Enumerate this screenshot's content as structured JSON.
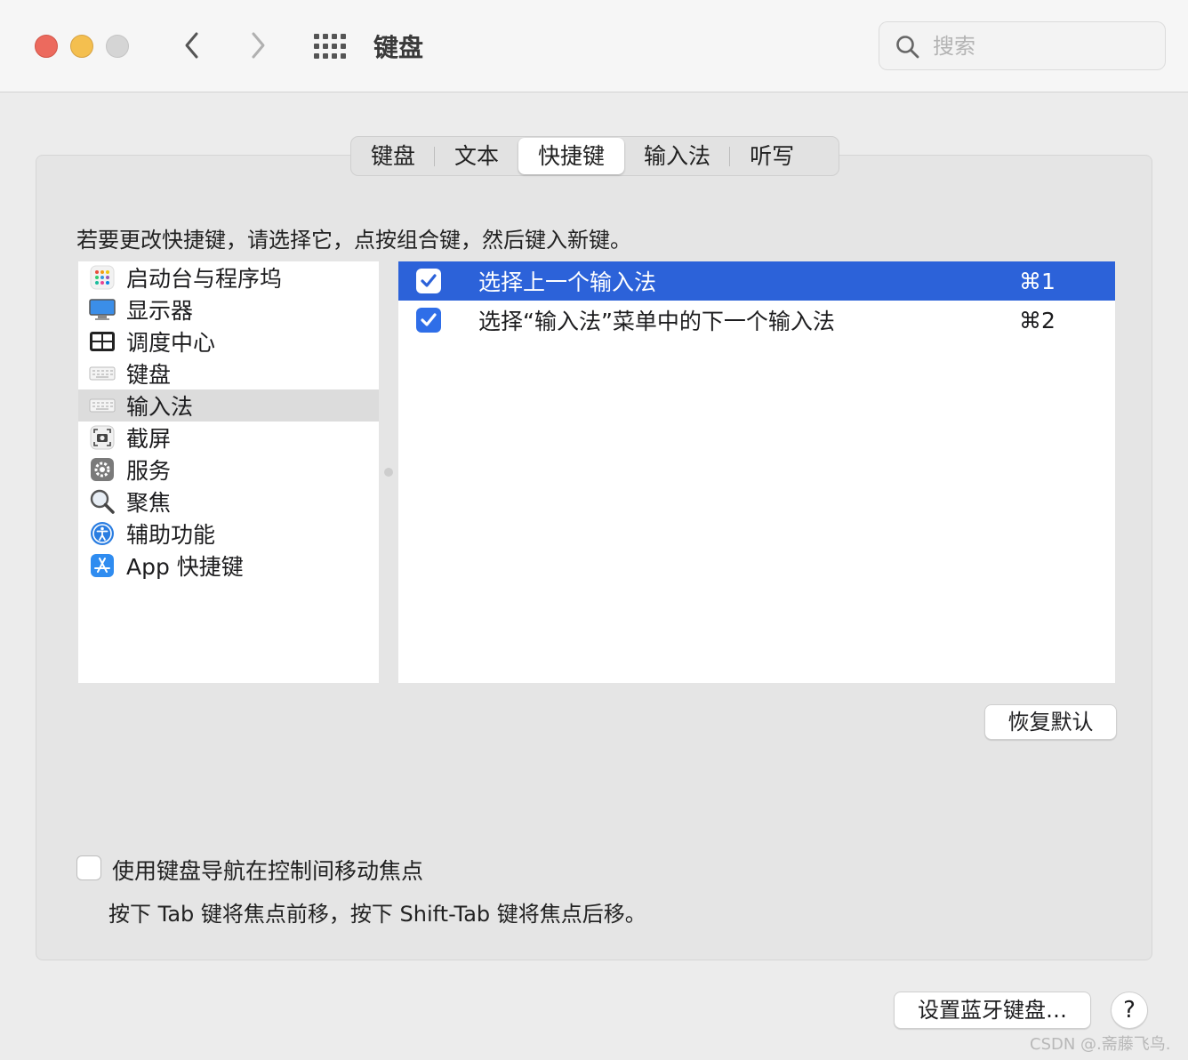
{
  "window": {
    "title": "键盘"
  },
  "search": {
    "placeholder": "搜索"
  },
  "tabs": [
    {
      "label": "键盘"
    },
    {
      "label": "文本"
    },
    {
      "label": "快捷键"
    },
    {
      "label": "输入法"
    },
    {
      "label": "听写"
    }
  ],
  "active_tab": "快捷键",
  "instructions": "若要更改快捷键，请选择它，点按组合键，然后键入新键。",
  "categories": [
    {
      "label": "启动台与程序坞",
      "icon": "launchpad-icon"
    },
    {
      "label": "显示器",
      "icon": "display-icon"
    },
    {
      "label": "调度中心",
      "icon": "mission-control-icon"
    },
    {
      "label": "键盘",
      "icon": "keyboard-icon"
    },
    {
      "label": "输入法",
      "icon": "keyboard-icon"
    },
    {
      "label": "截屏",
      "icon": "screenshot-icon"
    },
    {
      "label": "服务",
      "icon": "gear-icon"
    },
    {
      "label": "聚焦",
      "icon": "magnifier-icon"
    },
    {
      "label": "辅助功能",
      "icon": "accessibility-icon"
    },
    {
      "label": "App 快捷键",
      "icon": "app-store-icon"
    }
  ],
  "selected_category": "输入法",
  "shortcuts": [
    {
      "label": "选择上一个输入法",
      "keys": "⌘1",
      "checked": true
    },
    {
      "label": "选择“输入法”菜单中的下一个输入法",
      "keys": "⌘2",
      "checked": true
    }
  ],
  "restore_defaults_label": "恢复默认",
  "keyboard_navigation": {
    "label": "使用键盘导航在控制间移动焦点",
    "checked": false,
    "description": "按下 Tab 键将焦点前移，按下 Shift-Tab 键将焦点后移。"
  },
  "bluetooth_button_label": "设置蓝牙键盘…",
  "help_label": "?",
  "watermark": "CSDN @.斋藤飞鸟.",
  "colors": {
    "selection": "#2c62d9",
    "checkbox": "#2f6ee8"
  }
}
